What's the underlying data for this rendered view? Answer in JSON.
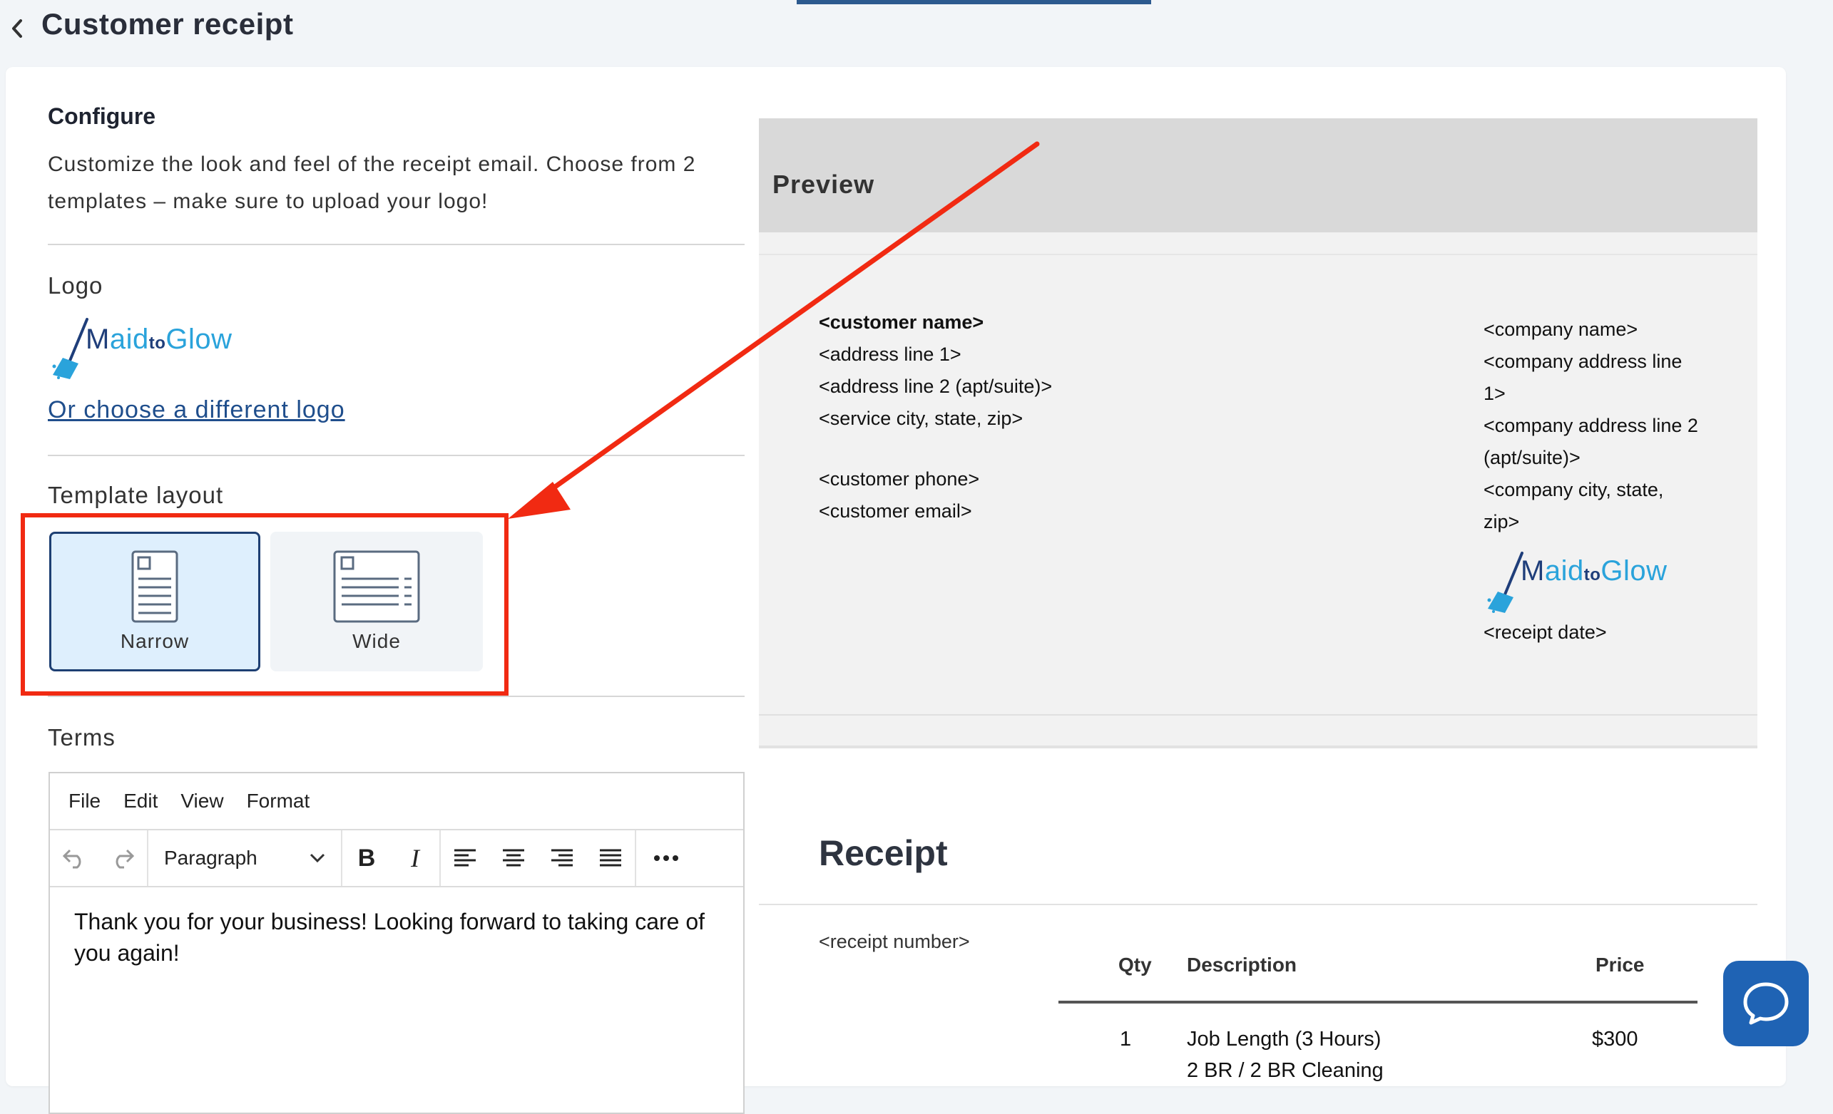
{
  "header": {
    "title": "Customer receipt"
  },
  "configure": {
    "title": "Configure",
    "description": "Customize the look and feel of the receipt email. Choose from 2 templates – make sure to upload your logo!"
  },
  "logo": {
    "label": "Logo",
    "brand_m": "M",
    "brand_aid": "aid",
    "brand_to": "to",
    "brand_glow": "Glow",
    "choose_link": "Or choose a different logo"
  },
  "template": {
    "label": "Template layout",
    "options": [
      {
        "label": "Narrow",
        "selected": true
      },
      {
        "label": "Wide",
        "selected": false
      }
    ]
  },
  "terms": {
    "label": "Terms",
    "menu": [
      "File",
      "Edit",
      "View",
      "Format"
    ],
    "block_format": "Paragraph",
    "content": "Thank you for your business! Looking forward to taking care of you again!"
  },
  "preview": {
    "title": "Preview",
    "customer": {
      "name": "<customer name>",
      "address1": "<address line 1>",
      "address2": "<address line 2 (apt/suite)>",
      "city": "<service city, state, zip>",
      "phone": "<customer phone>",
      "email": "<customer email>"
    },
    "company": {
      "name": "<company name>",
      "address1": "<company address line 1>",
      "address2": "<company address line 2 (apt/suite)>",
      "city": "<company city, state, zip>",
      "receipt_date": "<receipt date>"
    },
    "receipt_title": "Receipt",
    "receipt_number": "<receipt number>",
    "table": {
      "headers": [
        "Qty",
        "Description",
        "Price"
      ],
      "rows": [
        {
          "qty": "1",
          "description": "Job Length (3 Hours)",
          "description2": "2 BR / 2 BR Cleaning",
          "price": "$300"
        }
      ]
    }
  },
  "colors": {
    "accent": "#1d3f73",
    "highlight": "#f12a12",
    "link": "#1f4e8c",
    "brand_blue": "#2aa3db",
    "chat": "#1f63b4"
  }
}
